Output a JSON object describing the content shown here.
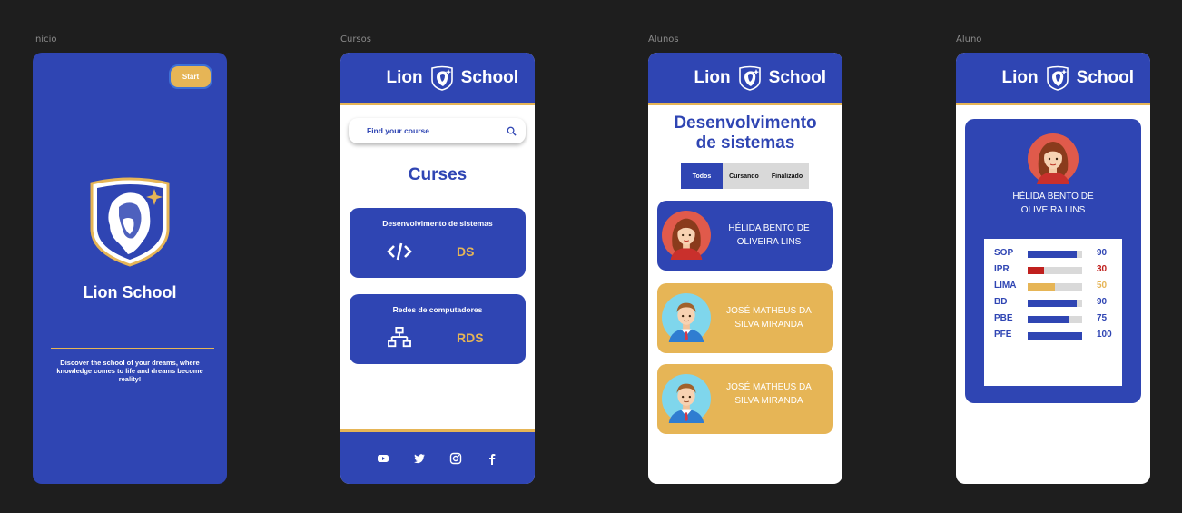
{
  "frames": {
    "inicio": "Inicio",
    "cursos": "Cursos",
    "alunos": "Alunos",
    "aluno": "Aluno"
  },
  "brand": {
    "name": "Lion School",
    "word1": "Lion",
    "word2": "School"
  },
  "colors": {
    "primary": "#2f45b3",
    "accent": "#e6b556",
    "low": "#c0201e",
    "background": "#1e1e1e"
  },
  "inicio": {
    "start_label": "Start",
    "tagline": "Discover the school of your dreams, where knowledge comes to life and dreams become reality!"
  },
  "cursos": {
    "search_placeholder": "Find your course",
    "title": "Curses",
    "courses": [
      {
        "name": "Desenvolvimento de sistemas",
        "abbr": "DS",
        "icon": "code-icon"
      },
      {
        "name": "Redes de computadores",
        "abbr": "RDS",
        "icon": "network-icon"
      }
    ],
    "social": [
      "youtube-icon",
      "twitter-icon",
      "instagram-icon",
      "facebook-icon"
    ]
  },
  "alunos": {
    "course_line1": "Desenvolvimento",
    "course_line2": "de sistemas",
    "filters": [
      "Todos",
      "Cursando",
      "Finalizado"
    ],
    "students": [
      {
        "line1": "HÉLIDA BENTO DE",
        "line2": "OLIVEIRA LINS",
        "status": "cursando"
      },
      {
        "line1": "JOSÉ MATHEUS DA",
        "line2": "SILVA MIRANDA",
        "status": "finalizado"
      },
      {
        "line1": "JOSÉ MATHEUS DA",
        "line2": "SILVA MIRANDA",
        "status": "finalizado"
      }
    ]
  },
  "aluno": {
    "name_line1": "HÉLIDA BENTO DE",
    "name_line2": "OLIVEIRA LINS",
    "grades": [
      {
        "subject": "SOP",
        "value": "90",
        "fraction": 0.9,
        "color": "#2f45b3"
      },
      {
        "subject": "IPR",
        "value": "30",
        "fraction": 0.3,
        "color": "#c0201e"
      },
      {
        "subject": "LIMA",
        "value": "50",
        "fraction": 0.5,
        "color": "#e6b556"
      },
      {
        "subject": "BD",
        "value": "90",
        "fraction": 0.9,
        "color": "#2f45b3"
      },
      {
        "subject": "PBE",
        "value": "75",
        "fraction": 0.75,
        "color": "#2f45b3"
      },
      {
        "subject": "PFE",
        "value": "100",
        "fraction": 1.0,
        "color": "#2f45b3"
      }
    ]
  }
}
